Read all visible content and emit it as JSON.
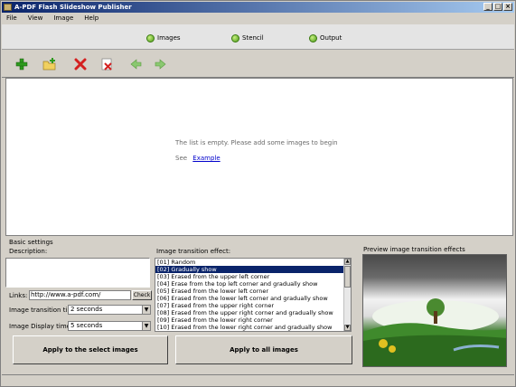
{
  "window": {
    "title": "A-PDF Flash Slideshow Publisher",
    "buttons": [
      "_",
      "□",
      "×"
    ]
  },
  "menu": [
    "File",
    "View",
    "Image",
    "Help"
  ],
  "tabs": [
    {
      "label": "Images",
      "icon": "images-icon"
    },
    {
      "label": "Stencil",
      "icon": "stencil-icon"
    },
    {
      "label": "Output",
      "icon": "output-icon"
    }
  ],
  "toolbar": {
    "add": "add-icon",
    "add_folder": "add-folder-icon",
    "delete": "delete-icon",
    "delete_all": "delete-all-icon",
    "move_up": "arrow-left-icon",
    "move_down": "arrow-right-icon"
  },
  "main": {
    "empty_text": "The list is empty. Please add some images to begin",
    "see_label": "See",
    "example_link": "Example"
  },
  "basic_settings": {
    "group_label": "Basic settings",
    "description_label": "Description:",
    "links_label": "Links:",
    "links_value": "http://www.a-pdf.com/",
    "check_button": "Check",
    "transition_time_label": "Image transition time:",
    "transition_time_value": "2 seconds",
    "display_time_label": "Image Display time:",
    "display_time_value": "5 seconds",
    "effects_label": "Image transition effect:",
    "effects": [
      "[01] Random",
      "[02] Gradually show",
      "[03] Erased from the upper left corner",
      "[04] Erase from the top left corner and gradually show",
      "[05] Erased from the lower left corner",
      "[06] Erased from the lower left corner and gradually show",
      "[07] Erased from the upper right corner",
      "[08] Erased from the upper right corner and gradually show",
      "[09] Erased from the lower right corner",
      "[10] Erased from the lower right corner and gradually show"
    ],
    "selected_effect": 1,
    "apply_select": "Apply to the select images",
    "apply_all": "Apply to all images"
  },
  "preview": {
    "group_label": "Preview image transition effects"
  },
  "colors": {
    "titlebar": "#0a246a",
    "link": "#0000cc",
    "selection": "#0a246a",
    "face": "#d4d0c8"
  }
}
